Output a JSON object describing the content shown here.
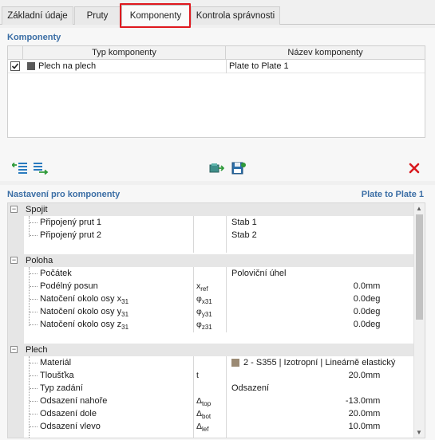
{
  "tabs": [
    {
      "label": "Základní údaje"
    },
    {
      "label": "Pruty"
    },
    {
      "label": "Komponenty"
    },
    {
      "label": "Kontrola správnosti"
    }
  ],
  "components": {
    "title": "Komponenty",
    "columns": [
      "Typ komponenty",
      "Název komponenty"
    ],
    "rows": [
      {
        "type": "Plech na plech",
        "name": "Plate to Plate 1",
        "checked": true
      }
    ]
  },
  "settings": {
    "title": "Nastavení pro komponenty",
    "current": "Plate to Plate 1",
    "sections": {
      "spojit": {
        "label": "Spojit",
        "rows": [
          {
            "name": "Připojený prut 1",
            "value": "Stab 1"
          },
          {
            "name": "Připojený prut 2",
            "value": "Stab 2"
          }
        ]
      },
      "poloha": {
        "label": "Poloha",
        "rows": [
          {
            "name": "Počátek",
            "value": "Poloviční úhel"
          },
          {
            "name": "Podélný posun",
            "sym": "x",
            "sub": "ref",
            "value": "0.0",
            "unit": "mm"
          },
          {
            "name": "Natočení okolo osy x",
            "nsub": "31",
            "sym": "φ",
            "sub": "x31",
            "value": "0.0",
            "unit": "deg"
          },
          {
            "name": "Natočení okolo osy y",
            "nsub": "31",
            "sym": "φ",
            "sub": "y31",
            "value": "0.0",
            "unit": "deg"
          },
          {
            "name": "Natočení okolo osy z",
            "nsub": "31",
            "sym": "φ",
            "sub": "z31",
            "value": "0.0",
            "unit": "deg"
          }
        ]
      },
      "plech": {
        "label": "Plech",
        "rows": [
          {
            "name": "Materiál",
            "value": "2 - S355 | Izotropní | Lineárně elastický"
          },
          {
            "name": "Tloušťka",
            "sym": "t",
            "sub": "",
            "value": "20.0",
            "unit": "mm"
          },
          {
            "name": "Typ zadání",
            "value": "Odsazení"
          },
          {
            "name": "Odsazení nahoře",
            "sym": "Δ",
            "sub": "top",
            "value": "-13.0",
            "unit": "mm"
          },
          {
            "name": "Odsazení dole",
            "sym": "Δ",
            "sub": "bot",
            "value": "20.0",
            "unit": "mm"
          },
          {
            "name": "Odsazení vlevo",
            "sym": "Δ",
            "sub": "lef",
            "value": "10.0",
            "unit": "mm"
          }
        ]
      }
    }
  },
  "colors": {
    "accent": "#3b6ea5",
    "highlight": "#e0191f",
    "material": "#9b8a74"
  }
}
